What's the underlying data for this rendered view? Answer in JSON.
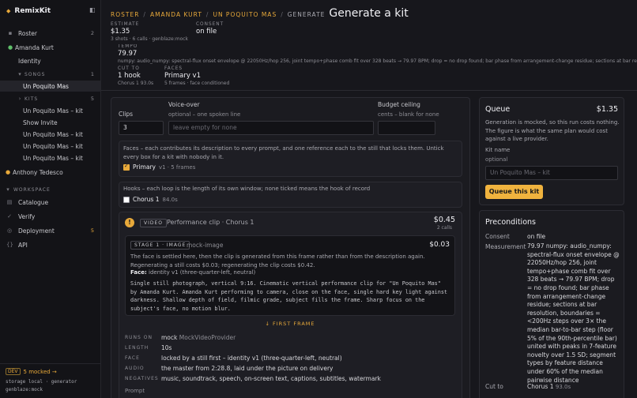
{
  "sidebar": {
    "brand": "RemixKit",
    "items": [
      {
        "label": "Roster",
        "count": "2"
      },
      {
        "label": "Amanda Kurt"
      },
      {
        "label": "Identity"
      },
      {
        "label": "SONGS",
        "count": "1"
      },
      {
        "label": "Un Poquito Mas"
      },
      {
        "label": "KITS",
        "count": "5"
      },
      {
        "label": "Un Poquito Mas – kit"
      },
      {
        "label": "Show Invite"
      },
      {
        "label": "Un Poquito Mas – kit"
      },
      {
        "label": "Un Poquito Mas – kit"
      },
      {
        "label": "Un Poquito Mas – kit"
      },
      {
        "label": "Anthony Tedesco"
      }
    ],
    "workspace_label": "WORKSPACE",
    "workspace": [
      {
        "label": "Catalogue"
      },
      {
        "label": "Verify"
      },
      {
        "label": "Deployment",
        "count": "5"
      },
      {
        "label": "API"
      }
    ],
    "dev_badge": "DEV",
    "dev_mocked": "5 mocked →",
    "storage": "storage local · generator",
    "generator": "genblaze:mock"
  },
  "header": {
    "crumbs": [
      "ROSTER",
      "AMANDA KURT",
      "UN POQUITO MAS"
    ],
    "current": "GENERATE",
    "title": "Generate a kit",
    "estimate_label": "ESTIMATE",
    "estimate_value": "$1.35",
    "estimate_sub": "3 shots · 6 calls · genblaze:mock",
    "consent_label": "CONSENT",
    "consent_value": "on file",
    "tempo_label": "TEMPO",
    "tempo_value": "79.97",
    "tempo_sub": "numpy: audio_numpy: spectral-flux onset envelope @ 22050Hz/hop 256, joint tempo+phase comb fit over 328 beats → 79.97 BPM; drop = no drop found; bar phase from arrangement-change residue; sections at bar resolution, boundaries",
    "cut_label": "CUT TO",
    "cut_value": "1 hook",
    "cut_sub": "Chorus 1 93.0s",
    "faces_label": "FACES",
    "faces_value": "Primary v1",
    "faces_sub": "5 frames · face conditioned"
  },
  "form": {
    "clips_label": "Clips",
    "clips_value": "3",
    "voiceover_label": "Voice-over",
    "voiceover_hint": "optional – one spoken line",
    "voiceover_placeholder": "leave empty for none",
    "budget_label": "Budget ceiling",
    "budget_hint": "cents – blank for none",
    "faces_desc": "Faces – each contributes its description to every prompt, and one reference each to the still that locks them. Untick every box for a kit with nobody in it.",
    "face_name": "Primary",
    "face_meta": "v1 · 5 frames",
    "hooks_desc": "Hooks – each loop is the length of its own window; none ticked means the hook of record",
    "hook_name": "Chorus 1",
    "hook_meta": "84.0s"
  },
  "clip": {
    "warn": "!",
    "tag": "VIDEO",
    "title": "Performance clip · Chorus 1",
    "price": "$0.45",
    "calls": "2 calls",
    "stage_tag": "STAGE 1 · IMAGE",
    "stage_provider": "mock-image",
    "stage_price": "$0.03",
    "stage_note": "The face is settled here, then the clip is generated from this frame rather than from the description again. Regenerating a still costs $0.03; regenerating the clip costs $0.42.",
    "face_line_label": "Face:",
    "face_line_value": "identity v1 (three-quarter-left, neutral)",
    "prompt": "Single still photograph, vertical 9:16. Cinematic vertical performance clip for \"Un Poquito Mas\" by Amanda Kurt. Amanda Kurt performing to camera, close on the face, single hard key light against darkness. Shallow depth of field, filmic grade, subject fills the frame. Sharp focus on the subject's face, no motion blur.",
    "first_frame": "↓ FIRST FRAME",
    "details": [
      {
        "k": "RUNS ON",
        "v": "mock",
        "v2": "MockVideoProvider"
      },
      {
        "k": "LENGTH",
        "v": "10s"
      },
      {
        "k": "FACE",
        "v": "locked by a still first – identity v1 (three-quarter-left, neutral)"
      },
      {
        "k": "AUDIO",
        "v": "the master from 2:28.8, laid under the picture on delivery"
      },
      {
        "k": "NEGATIVES",
        "v": "music, soundtrack, speech, on-screen text, captions, subtitles, watermark"
      }
    ],
    "prompt_label": "Prompt"
  },
  "queue": {
    "title": "Queue",
    "total": "$1.35",
    "note": "Generation is mocked, so this run costs nothing. The figure is what the same plan would cost against a live provider.",
    "kit_label": "Kit name",
    "kit_hint": "optional",
    "kit_placeholder": "Un Poquito Mas – kit",
    "button": "Queue this kit"
  },
  "preconditions": {
    "title": "Preconditions",
    "consent_k": "Consent",
    "consent_v": "on file",
    "measure_k": "Measurement",
    "measure_v": "79.97 numpy: audio_numpy: spectral-flux onset envelope @ 22050Hz/hop 256, joint tempo+phase comb fit over 328 beats → 79.97 BPM; drop = no drop found; bar phase from arrangement-change residue; sections at bar resolution, boundaries = <200Hz steps over 3× the median bar-to-bar step (floor 5% of the 90th-percentile bar) united with peaks in 7-feature novelty over 1.5 SD; segment types by feature distance under 60% of the median pairwise distance",
    "cut_k": "Cut to",
    "cut_v": "Chorus 1",
    "cut_v2": "93.0s"
  }
}
